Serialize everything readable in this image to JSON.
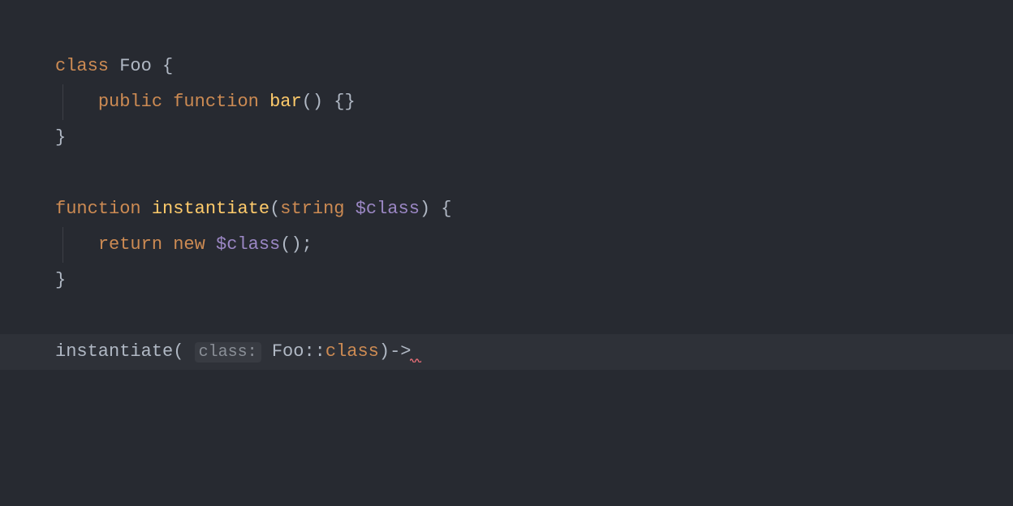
{
  "code": {
    "kw_class": "class",
    "space": " ",
    "class_name": "Foo",
    "brace_open_sp": " {",
    "indent": "    ",
    "kw_public": "public",
    "kw_function": "function",
    "fn_bar": "bar",
    "parens_empty": "()",
    "braces_empty": " {}",
    "brace_close": "}",
    "fn_instantiate": "instantiate",
    "paren_open": "(",
    "type_string": "string",
    "var_class": "$class",
    "paren_close_brace": ") {",
    "kw_return": "return",
    "kw_new": "new",
    "parens_semi": "();",
    "call_instantiate": "instantiate",
    "hint_class": "class:",
    "sp_after_hint": " ",
    "foo_scope": "Foo::",
    "class_const": "class",
    "paren_close_arrow": ")->"
  },
  "colors": {
    "bg": "#272a31",
    "fg": "#b0b8c4",
    "keyword": "#cd8b53",
    "fn_def": "#ffcb6b",
    "var": "#9b87c4",
    "hint_bg": "rgba(255,255,255,0.05)",
    "hint_fg": "#8a8f97",
    "error": "#e06c75"
  }
}
